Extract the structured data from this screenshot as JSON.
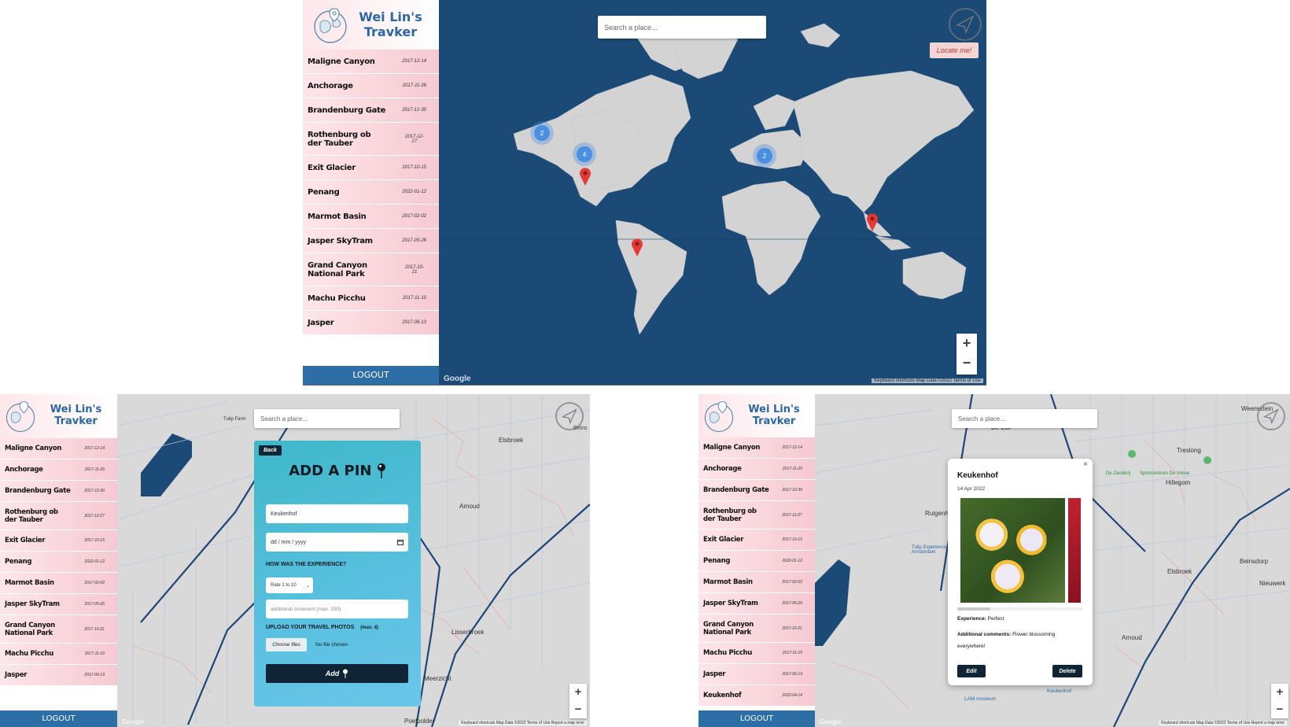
{
  "app": {
    "title_line1": "Wei Lin's",
    "title_line2": "Travker",
    "logout_label": "LOGOUT",
    "search_placeholder": "Search a place...",
    "locate_label": "Locate me!",
    "map_footer": "Keyboard shortcuts   Map Data ©2022   Terms of Use",
    "map_footer_small": "Keyboard shortcuts   Map Data ©2022   Terms of Use   Report a map error",
    "google_label": "Google",
    "zoom_in": "+",
    "zoom_out": "−"
  },
  "places": [
    {
      "name": "Maligne Canyon",
      "date": "2017-12-14"
    },
    {
      "name": "Anchorage",
      "date": "2017-11-26"
    },
    {
      "name": "Brandenburg Gate",
      "date": "2017-12-30"
    },
    {
      "name": "Rothenburg ob der Tauber",
      "date": "2017-12-27"
    },
    {
      "name": "Exit Glacier",
      "date": "2017-10-15"
    },
    {
      "name": "Penang",
      "date": "2022-01-12"
    },
    {
      "name": "Marmot Basin",
      "date": "2017-02-02"
    },
    {
      "name": "Jasper SkyTram",
      "date": "2017-05-26"
    },
    {
      "name": "Grand Canyon National Park",
      "date": "2017-10-21"
    },
    {
      "name": "Machu Picchu",
      "date": "2017-11-10"
    },
    {
      "name": "Jasper",
      "date": "2017-06-13"
    },
    {
      "name": "Keukenhof",
      "date": "2022-04-14"
    }
  ],
  "world_map": {
    "clusters": [
      {
        "label": "2"
      },
      {
        "label": "4"
      },
      {
        "label": "2"
      }
    ]
  },
  "map_labels": {
    "left": [
      "Tulip Farm",
      "Elsbroek",
      "Arnoud",
      "Lisserbroek",
      "Meerzicht",
      "Poelpolder",
      "Beins"
    ],
    "right": [
      "Weerestein",
      "De Zilk",
      "Ruigenhoek",
      "Treslong",
      "Hillegom",
      "Elsbroek",
      "Beinsdorp",
      "Nieuwerk",
      "Arnoud",
      "Tulip Experience Amsterdam",
      "Sportcentrum De Vosse",
      "De Zanderij",
      "LAM museum",
      "Keukenhof"
    ]
  },
  "add_pin": {
    "back_label": "Back",
    "title": "ADD A PIN",
    "name_value": "Keukenhof",
    "date_placeholder": "dd / mm / yyyy",
    "experience_label": "HOW WAS THE EXPERIENCE?",
    "rating_value": "Rate 1 to 10",
    "comment_placeholder": "additional comment (max. 150)",
    "upload_label": "UPLOAD YOUR TRAVEL PHOTOS",
    "upload_max": "(max. 4)",
    "choose_files": "Choose files",
    "no_file": "No file chosen",
    "add_label": "Add"
  },
  "popup": {
    "close": "×",
    "title": "Keukenhof",
    "date": "14 Apr 2022",
    "experience_label": "Experience:",
    "experience_value": "Perfect",
    "comments_label": "Additional comments:",
    "comments_value": "Flower blossoming everywhere!",
    "edit_label": "Edit",
    "delete_label": "Delete"
  },
  "colors": {
    "ocean": "#1b4a77",
    "land": "#d3d3d3",
    "accent_blue": "#2e6ea6",
    "pin_red": "#e53935",
    "form_gradient_start": "#3fb8c9",
    "form_gradient_end": "#5fc3e6",
    "dark_button": "#0f2434"
  }
}
